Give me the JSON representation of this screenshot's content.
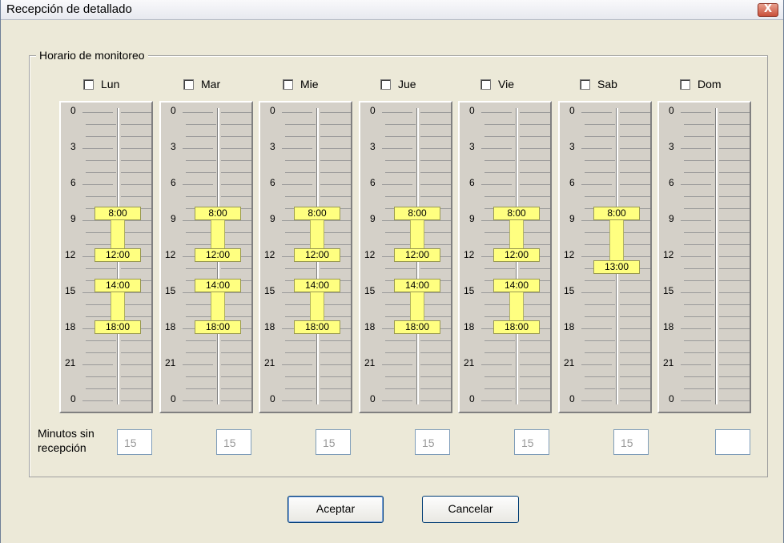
{
  "window": {
    "title": "Recepción de detallado",
    "close_glyph": "X"
  },
  "group": {
    "legend": "Horario de monitoreo"
  },
  "days": [
    {
      "label": "Lun",
      "checked": false,
      "minutes": "15",
      "ranges": [
        {
          "start_label": "8:00",
          "end_label": "12:00"
        },
        {
          "start_label": "14:00",
          "end_label": "18:00"
        }
      ]
    },
    {
      "label": "Mar",
      "checked": false,
      "minutes": "15",
      "ranges": [
        {
          "start_label": "8:00",
          "end_label": "12:00"
        },
        {
          "start_label": "14:00",
          "end_label": "18:00"
        }
      ]
    },
    {
      "label": "Mie",
      "checked": false,
      "minutes": "15",
      "ranges": [
        {
          "start_label": "8:00",
          "end_label": "12:00"
        },
        {
          "start_label": "14:00",
          "end_label": "18:00"
        }
      ]
    },
    {
      "label": "Jue",
      "checked": false,
      "minutes": "15",
      "ranges": [
        {
          "start_label": "8:00",
          "end_label": "12:00"
        },
        {
          "start_label": "14:00",
          "end_label": "18:00"
        }
      ]
    },
    {
      "label": "Vie",
      "checked": false,
      "minutes": "15",
      "ranges": [
        {
          "start_label": "8:00",
          "end_label": "12:00"
        },
        {
          "start_label": "14:00",
          "end_label": "18:00"
        }
      ]
    },
    {
      "label": "Sab",
      "checked": false,
      "minutes": "15",
      "ranges": [
        {
          "start_label": "8:00",
          "end_label": "13:00"
        }
      ]
    },
    {
      "label": "Dom",
      "checked": false,
      "minutes": "",
      "ranges": []
    }
  ],
  "hour_labels": [
    "0",
    "3",
    "6",
    "9",
    "12",
    "15",
    "18",
    "21",
    "0"
  ],
  "minutes_label": "Minutos sin recepción",
  "buttons": {
    "accept": "Aceptar",
    "cancel": "Cancelar"
  },
  "colors": {
    "block": "#ffff80",
    "face": "#d4d0c8",
    "dialog": "#ece9d8"
  }
}
